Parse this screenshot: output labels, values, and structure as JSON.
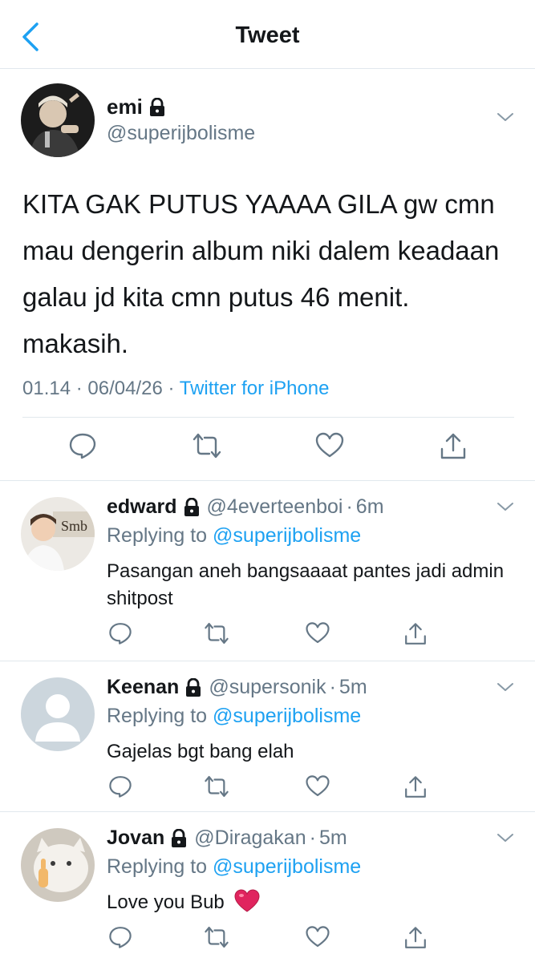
{
  "header": {
    "title": "Tweet"
  },
  "tweet": {
    "name": "emi",
    "handle": "@superijbolisme",
    "text": "KITA GAK PUTUS YAAAA GILA gw cmn mau dengerin album niki dalem keadaan galau jd kita cmn putus 46 menit. makasih.",
    "time": "01.14",
    "date": "06/04/26",
    "separator": "·",
    "source": "Twitter for iPhone"
  },
  "replies": [
    {
      "name": "edward",
      "handle": "@4everteenboi",
      "dot": "·",
      "time": "6m",
      "replying_label": "Replying to",
      "replying_to": "@superijbolisme",
      "text": "Pasangan aneh bangsaaaat pantes jadi admin shitpost"
    },
    {
      "name": "Keenan",
      "handle": "@supersonik",
      "dot": "·",
      "time": "5m",
      "replying_label": "Replying to",
      "replying_to": "@superijbolisme",
      "text": "Gajelas bgt bang elah"
    },
    {
      "name": "Jovan",
      "handle": "@Diragakan",
      "dot": "·",
      "time": "5m",
      "replying_label": "Replying to",
      "replying_to": "@superijbolisme",
      "text": "Love you Bub",
      "emoji": "❤️"
    }
  ],
  "colors": {
    "accent": "#1da1f2",
    "muted": "#657786",
    "divider": "#e1e8ed",
    "heart_emoji": "#e0245e"
  }
}
